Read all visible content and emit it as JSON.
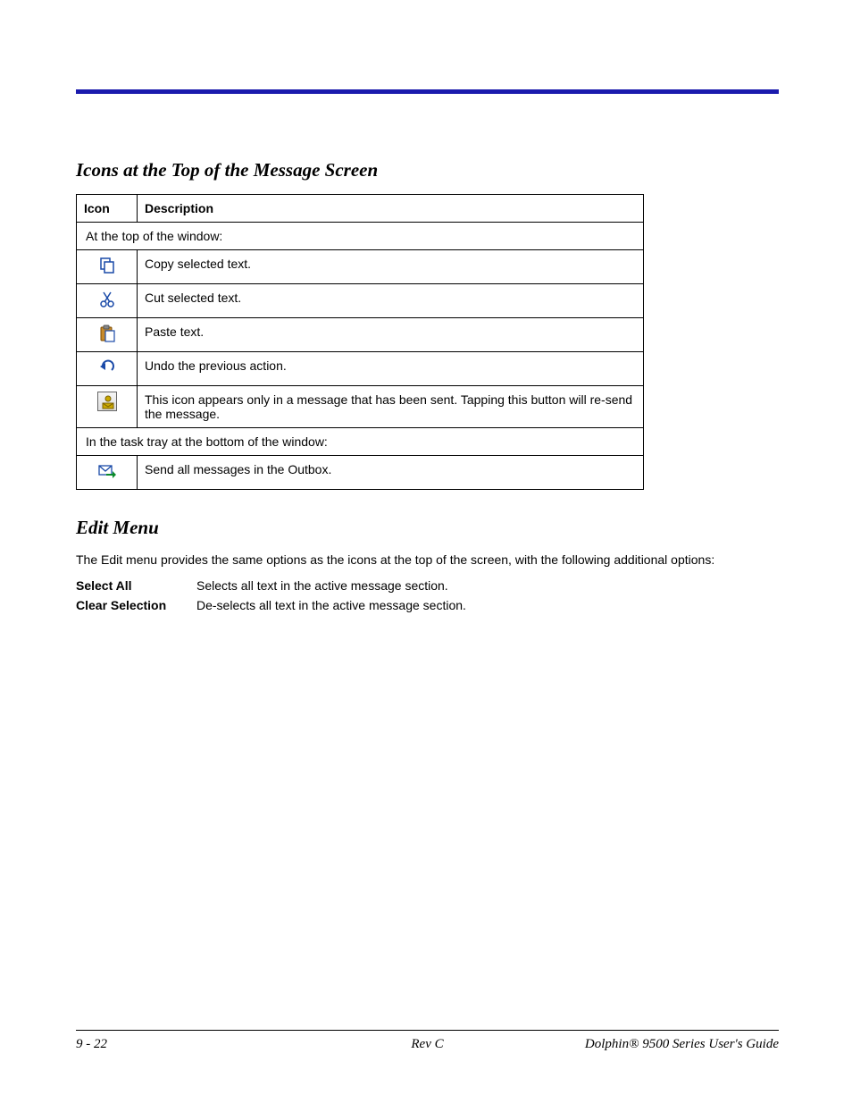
{
  "section1": {
    "title": "Icons at the Top of the Message Screen",
    "headers": {
      "icon": "Icon",
      "desc": "Description"
    },
    "span1": "At the top of the window:",
    "rows": [
      {
        "icon": "copy",
        "desc": "Copy selected text."
      },
      {
        "icon": "cut",
        "desc": "Cut selected text."
      },
      {
        "icon": "paste",
        "desc": "Paste text."
      },
      {
        "icon": "undo",
        "desc": "Undo the previous action."
      },
      {
        "icon": "resend",
        "desc": "This icon appears only in a message that has been sent. Tapping this button will re-send the message."
      }
    ],
    "span2": "In the task tray at the bottom of the window:",
    "rows2": [
      {
        "icon": "sendall",
        "desc": "Send all messages in the Outbox."
      }
    ]
  },
  "section2": {
    "title": "Edit Menu",
    "intro": "The Edit menu provides the same options as the icons at the top of the screen, with the following additional options:",
    "defs": [
      {
        "term": "Select All",
        "desc": "Selects all text in the active message section."
      },
      {
        "term": "Clear Selection",
        "desc": "De-selects all text in the active message section."
      }
    ]
  },
  "footer": {
    "left": "9 - 22",
    "center": "Rev C",
    "right": "Dolphin® 9500 Series User's Guide"
  }
}
